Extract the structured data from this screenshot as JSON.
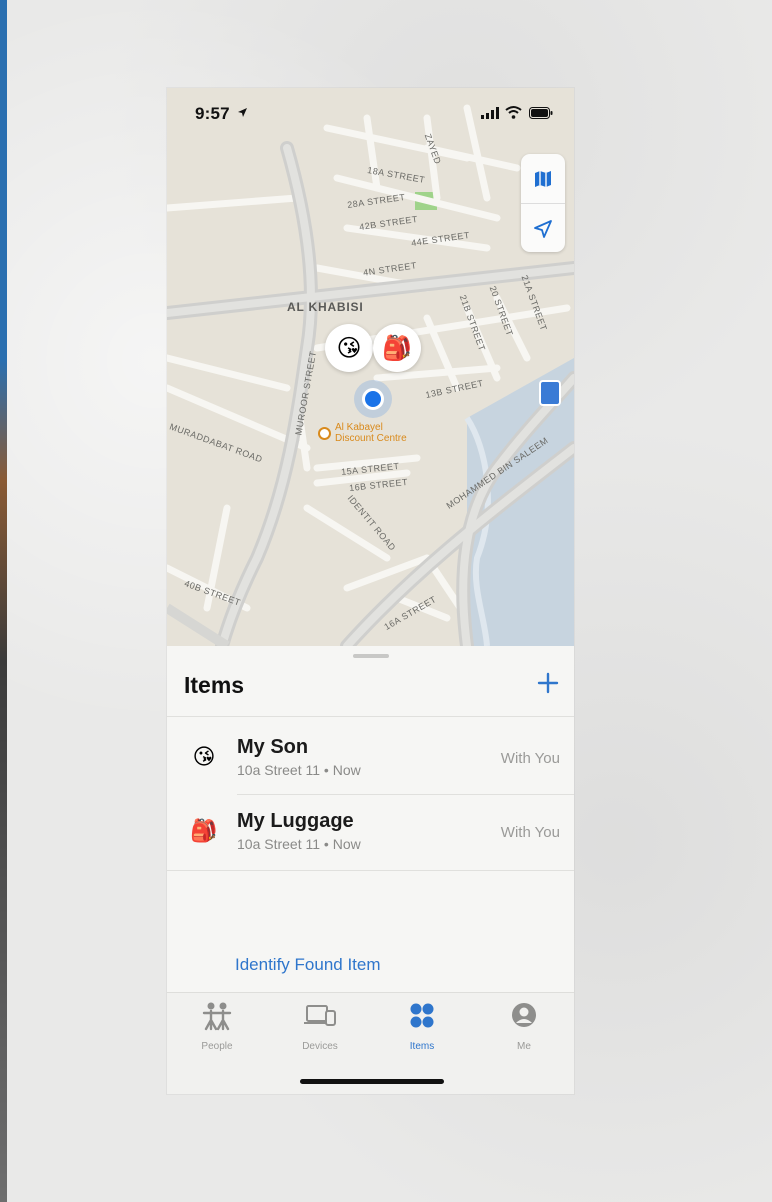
{
  "status_bar": {
    "time": "9:57"
  },
  "map": {
    "road_label": "AL KHABISI",
    "street_labels": [
      "18A STREET",
      "28A STREET",
      "42B STREET",
      "44E STREET",
      "4N STREET",
      "21B STREET",
      "20 STREET",
      "21A STREET",
      "13B STREET",
      "15A STREET",
      "16B STREET",
      "16A STREET",
      "40B STREET",
      "MUROOR STREET",
      "MOHAMMED BIN SALEEM",
      "ZAYED",
      "IDENTIT ROAD",
      "MURADDABAT ROAD"
    ],
    "poi": {
      "name_line1": "Al Kabayel",
      "name_line2": "Discount Centre"
    },
    "buttons": {
      "map_mode_icon": "map-icon",
      "locate_icon": "location-arrow-icon"
    },
    "pins": [
      {
        "emoji": "😘",
        "name": "son-pin"
      },
      {
        "emoji": "🎒",
        "name": "luggage-pin"
      }
    ]
  },
  "sheet": {
    "title": "Items",
    "add_icon": "plus-icon",
    "items": [
      {
        "emoji": "😘",
        "name": "My Son",
        "subtitle": "10a Street 11 • Now",
        "status": "With You"
      },
      {
        "emoji": "🎒",
        "name": "My Luggage",
        "subtitle": "10a Street 11 • Now",
        "status": "With You"
      }
    ],
    "identify_label": "Identify Found Item"
  },
  "tabs": [
    {
      "label": "People",
      "icon": "people-icon",
      "active": false
    },
    {
      "label": "Devices",
      "icon": "devices-icon",
      "active": false
    },
    {
      "label": "Items",
      "icon": "items-icon",
      "active": true
    },
    {
      "label": "Me",
      "icon": "person-circle-icon",
      "active": false
    }
  ],
  "colors": {
    "accent": "#2f76cc",
    "water": "#c7d4df",
    "land": "#e6e2d8",
    "park": "#9fd38a",
    "poi": "#d98a1c"
  }
}
